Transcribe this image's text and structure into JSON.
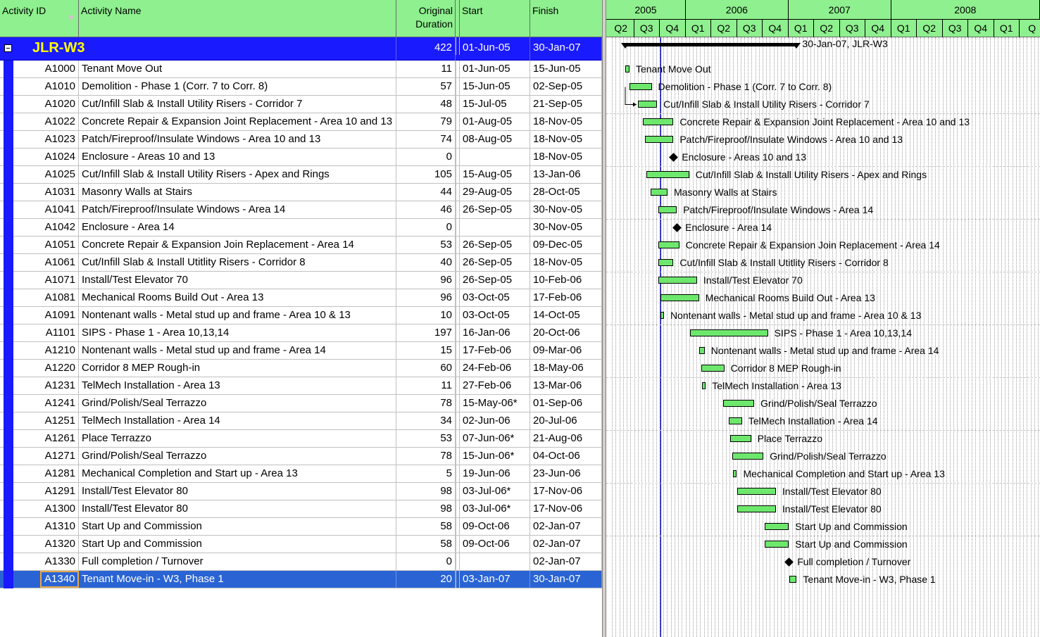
{
  "columns": {
    "activity_id": "Activity ID",
    "activity_name": "Activity Name",
    "original_duration_line1": "Original",
    "original_duration_line2": "Duration",
    "start": "Start",
    "finish": "Finish"
  },
  "project": {
    "name": "JLR-W3",
    "duration": "422",
    "start": "01-Jun-05",
    "finish": "30-Jan-07",
    "bar_label": "30-Jan-07, JLR-W3"
  },
  "timeline": {
    "years": [
      "2005",
      "2006",
      "2007",
      "2008"
    ],
    "quarters": [
      "Q2",
      "Q3",
      "Q4",
      "Q1",
      "Q2",
      "Q3",
      "Q4",
      "Q1",
      "Q2",
      "Q3",
      "Q4",
      "Q1",
      "Q2",
      "Q3",
      "Q4",
      "Q1",
      "Q"
    ]
  },
  "activities": [
    {
      "id": "A1000",
      "name": "Tenant Move Out",
      "dur": "11",
      "start": "01-Jun-05",
      "finish": "15-Jun-05"
    },
    {
      "id": "A1010",
      "name": "Demolition - Phase 1 (Corr. 7 to Corr. 8)",
      "dur": "57",
      "start": "15-Jun-05",
      "finish": "02-Sep-05"
    },
    {
      "id": "A1020",
      "name": "Cut/Infill Slab & Install Utility Risers - Corridor 7",
      "dur": "48",
      "start": "15-Jul-05",
      "finish": "21-Sep-05"
    },
    {
      "id": "A1022",
      "name": "Concrete Repair & Expansion Joint Replacement - Area 10 and 13",
      "dur": "79",
      "start": "01-Aug-05",
      "finish": "18-Nov-05"
    },
    {
      "id": "A1023",
      "name": "Patch/Fireproof/Insulate Windows - Area 10 and 13",
      "dur": "74",
      "start": "08-Aug-05",
      "finish": "18-Nov-05"
    },
    {
      "id": "A1024",
      "name": "Enclosure - Areas 10 and 13",
      "dur": "0",
      "start": "",
      "finish": "18-Nov-05"
    },
    {
      "id": "A1025",
      "name": "Cut/Infill Slab & Install Utility Risers - Apex and Rings",
      "dur": "105",
      "start": "15-Aug-05",
      "finish": "13-Jan-06"
    },
    {
      "id": "A1031",
      "name": "Masonry Walls at Stairs",
      "dur": "44",
      "start": "29-Aug-05",
      "finish": "28-Oct-05"
    },
    {
      "id": "A1041",
      "name": "Patch/Fireproof/Insulate Windows - Area 14",
      "dur": "46",
      "start": "26-Sep-05",
      "finish": "30-Nov-05"
    },
    {
      "id": "A1042",
      "name": "Enclosure - Area 14",
      "dur": "0",
      "start": "",
      "finish": "30-Nov-05"
    },
    {
      "id": "A1051",
      "name": "Concrete Repair & Expansion Join Replacement - Area 14",
      "dur": "53",
      "start": "26-Sep-05",
      "finish": "09-Dec-05"
    },
    {
      "id": "A1061",
      "name": "Cut/Infill Slab & Install Utitlity Risers - Corridor 8",
      "dur": "40",
      "start": "26-Sep-05",
      "finish": "18-Nov-05"
    },
    {
      "id": "A1071",
      "name": "Install/Test Elevator 70",
      "dur": "96",
      "start": "26-Sep-05",
      "finish": "10-Feb-06"
    },
    {
      "id": "A1081",
      "name": "Mechanical Rooms Build Out - Area 13",
      "dur": "96",
      "start": "03-Oct-05",
      "finish": "17-Feb-06"
    },
    {
      "id": "A1091",
      "name": "Nontenant walls - Metal stud up and frame - Area 10 & 13",
      "dur": "10",
      "start": "03-Oct-05",
      "finish": "14-Oct-05"
    },
    {
      "id": "A1101",
      "name": "SIPS - Phase 1 - Area 10,13,14",
      "dur": "197",
      "start": "16-Jan-06",
      "finish": "20-Oct-06"
    },
    {
      "id": "A1210",
      "name": "Nontenant walls - Metal stud up and frame - Area 14",
      "dur": "15",
      "start": "17-Feb-06",
      "finish": "09-Mar-06"
    },
    {
      "id": "A1220",
      "name": "Corridor 8  MEP Rough-in",
      "dur": "60",
      "start": "24-Feb-06",
      "finish": "18-May-06"
    },
    {
      "id": "A1231",
      "name": "TelMech Installation - Area 13",
      "dur": "11",
      "start": "27-Feb-06",
      "finish": "13-Mar-06"
    },
    {
      "id": "A1241",
      "name": "Grind/Polish/Seal Terrazzo",
      "dur": "78",
      "start": "15-May-06*",
      "finish": "01-Sep-06"
    },
    {
      "id": "A1251",
      "name": "TelMech Installation - Area 14",
      "dur": "34",
      "start": "02-Jun-06",
      "finish": "20-Jul-06"
    },
    {
      "id": "A1261",
      "name": "Place Terrazzo",
      "dur": "53",
      "start": "07-Jun-06*",
      "finish": "21-Aug-06"
    },
    {
      "id": "A1271",
      "name": "Grind/Polish/Seal Terrazzo",
      "dur": "78",
      "start": "15-Jun-06*",
      "finish": "04-Oct-06"
    },
    {
      "id": "A1281",
      "name": "Mechanical Completion and Start up - Area 13",
      "dur": "5",
      "start": "19-Jun-06",
      "finish": "23-Jun-06"
    },
    {
      "id": "A1291",
      "name": "Install/Test Elevator 80",
      "dur": "98",
      "start": "03-Jul-06*",
      "finish": "17-Nov-06"
    },
    {
      "id": "A1300",
      "name": "Install/Test Elevator 80",
      "dur": "98",
      "start": "03-Jul-06*",
      "finish": "17-Nov-06"
    },
    {
      "id": "A1310",
      "name": "Start Up and Commission",
      "dur": "58",
      "start": "09-Oct-06",
      "finish": "02-Jan-07"
    },
    {
      "id": "A1320",
      "name": "Start Up and Commission",
      "dur": "58",
      "start": "09-Oct-06",
      "finish": "02-Jan-07"
    },
    {
      "id": "A1330",
      "name": "Full completion / Turnover",
      "dur": "0",
      "start": "",
      "finish": "02-Jan-07"
    },
    {
      "id": "A1340",
      "name": "Tenant Move-in - W3, Phase 1",
      "dur": "20",
      "start": "03-Jan-07",
      "finish": "30-Jan-07"
    }
  ],
  "selected_activity": "A1340",
  "colors": {
    "header_green": "#8ef08e",
    "bar_green": "#6de86d",
    "wbs_blue": "#1a1aff",
    "selection_blue": "#2a64d4",
    "wbs_text_yellow": "#ffff00",
    "data_date_line": "#1a1acc"
  }
}
